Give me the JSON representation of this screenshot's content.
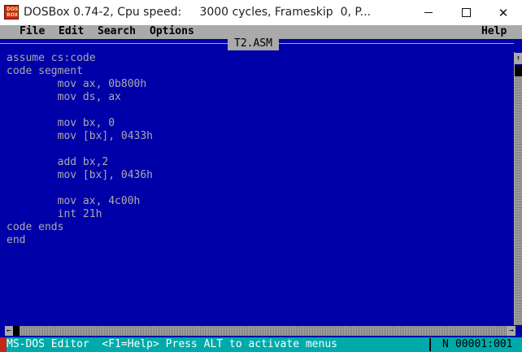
{
  "window": {
    "title": "DOSBox 0.74-2, Cpu speed:     3000 cycles, Frameskip  0, P...",
    "icon_text_top": "DOS",
    "icon_text_bottom": "BOX",
    "minimize_glyph": "",
    "maximize_glyph": "",
    "close_glyph": "✕"
  },
  "menubar": {
    "items": [
      "File",
      "Edit",
      "Search",
      "Options"
    ],
    "help": "Help"
  },
  "editor": {
    "filename": "T2.ASM",
    "lines": [
      "assume cs:code",
      "code segment",
      "        mov ax, 0b800h",
      "        mov ds, ax",
      "",
      "        mov bx, 0",
      "        mov [bx], 0433h",
      "",
      "        add bx,2",
      "        mov [bx], 0436h",
      "",
      "        mov ax, 4c00h",
      "        int 21h",
      "code ends",
      "end"
    ]
  },
  "scrollbars": {
    "up_arrow": "↑",
    "left_arrow": "←",
    "right_arrow": "→"
  },
  "statusbar": {
    "text": "MS-DOS Editor  <F1=Help> Press ALT to activate menus",
    "mode": "N",
    "position": "00001:001"
  },
  "colors": {
    "dos_blue": "#0000a8",
    "dos_gray": "#aaaaaa",
    "status_cyan": "#00aaaa",
    "icon_red": "#c4281a"
  }
}
